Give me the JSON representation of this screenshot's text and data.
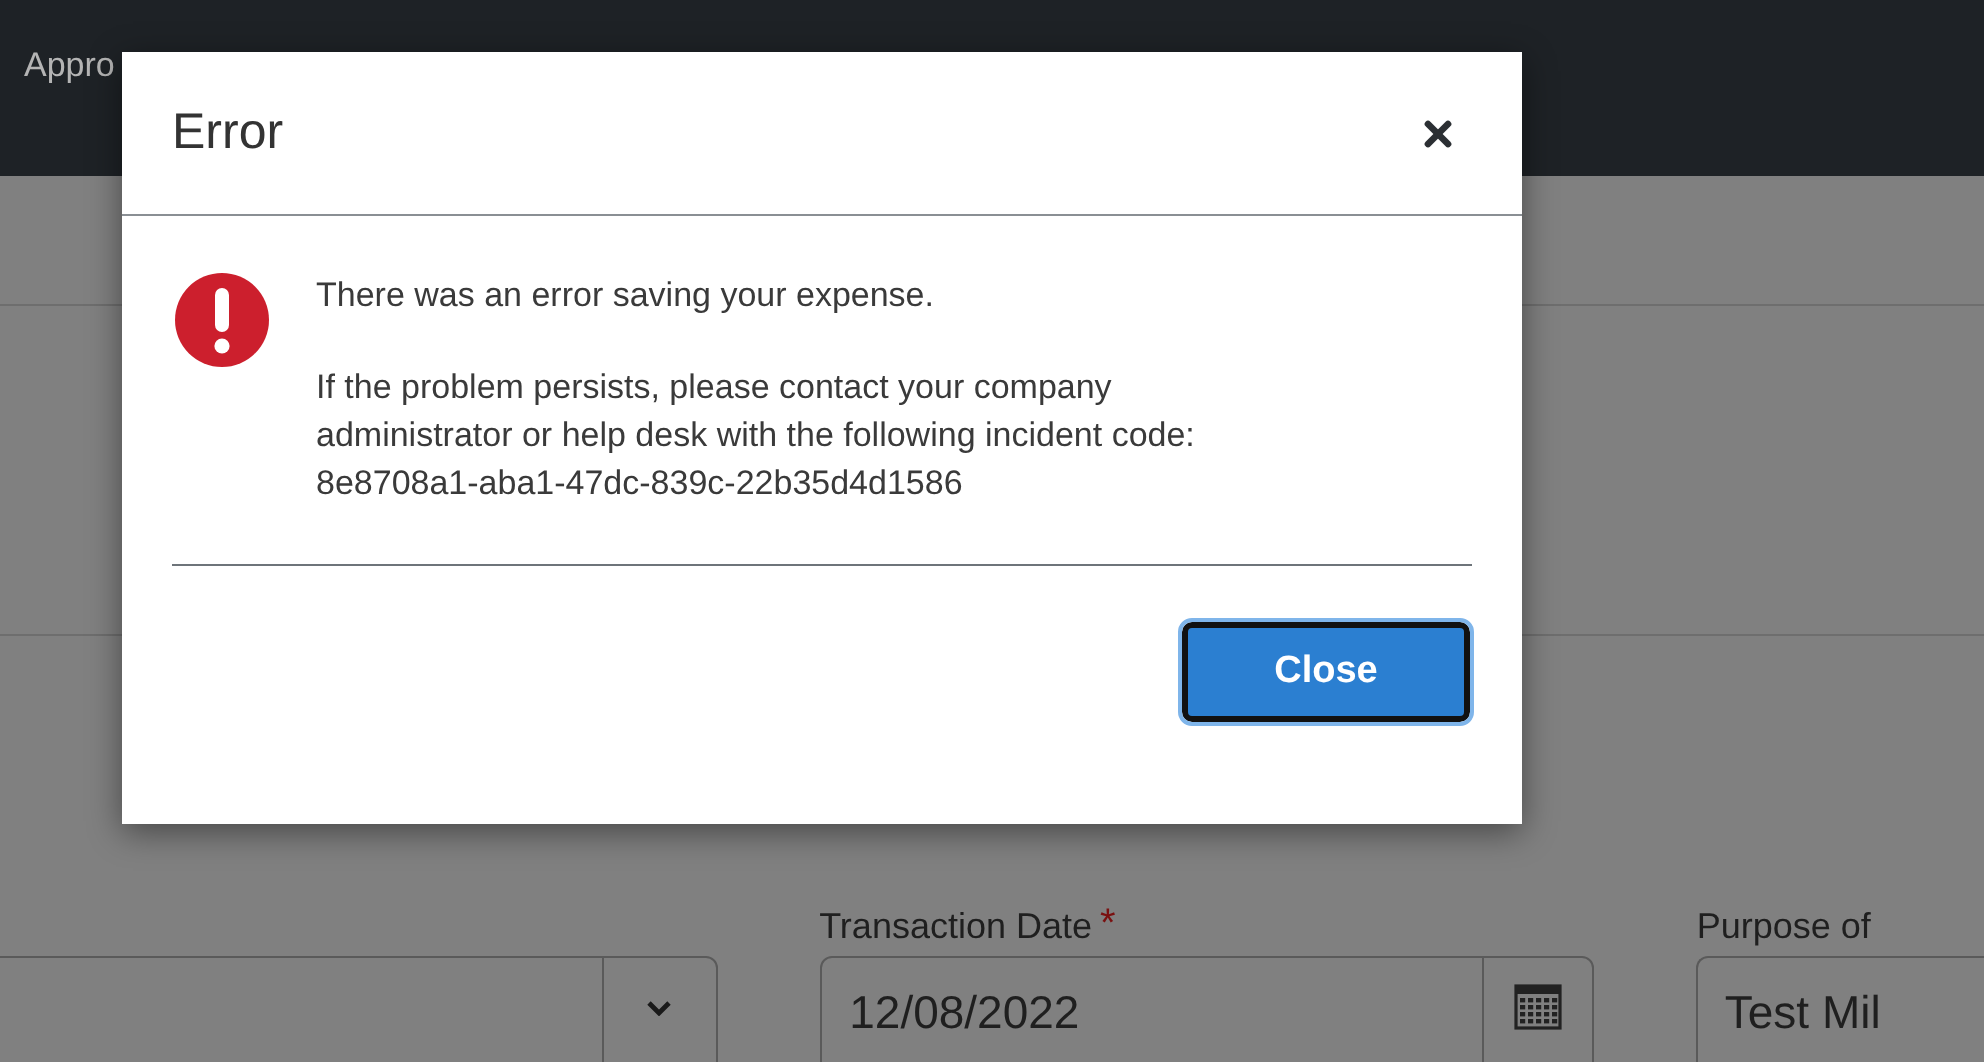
{
  "nav": {
    "items": [
      {
        "label": "Appro"
      }
    ]
  },
  "form": {
    "fields": [
      {
        "kind": "select"
      },
      {
        "kind": "date",
        "label": "Transaction Date",
        "required_mark": "*",
        "value": "12/08/2022"
      },
      {
        "kind": "text",
        "label": "Purpose of",
        "value": "Test Mil"
      }
    ]
  },
  "dialog": {
    "title": "Error",
    "message": "There was an error saving your expense.",
    "detail": "If the problem persists, please contact your company administrator or help desk with the following incident code:",
    "incident_code": "8e8708a1-aba1-47dc-839c-22b35d4d1586",
    "buttons": [
      {
        "label": "Close",
        "focused": true
      }
    ]
  }
}
